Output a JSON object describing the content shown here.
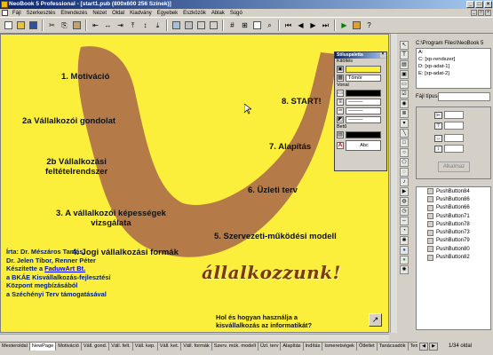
{
  "window": {
    "title": "NeoBook 5 Professional - [start1.pub (800x600 256 Színek)]"
  },
  "menu": {
    "items": [
      "Fájl",
      "Szerkesztés",
      "Elrendezés",
      "Nézet",
      "Oldal",
      "Kiadvány",
      "Egyebek",
      "Eszközök",
      "Ablak",
      "Súgó"
    ]
  },
  "canvas": {
    "items": [
      "1. Motiváció",
      "2a Vállalkozói gondolat",
      "2b Vállalkozási\nfeltételrendszer",
      "3. A vállalkozói képességek\nvizsgálata",
      "4. Jogi vállalkozási formák",
      "5. Szervezeti-működési modell",
      "6. Üzleti terv",
      "7. Alapítás",
      "8. START!"
    ],
    "credits": {
      "line1": "Írta: Dr. Mészáros Tamás,",
      "line2": "Dr. Jelen Tibor, Renner Péter",
      "line3_prefix": "Készítette a ",
      "line3_link": "FaduwArt Bt.",
      "line4": "a BKÁE Kisvállalkozás-fejlesztési",
      "line5": "Központ megbízásából",
      "line6": "a Széchényi Terv támogatásával"
    },
    "logo": "állalkozzunk!",
    "question_line1": "Hol és hogyan használja a",
    "question_line2": "kisvállalkozás az informatikát?",
    "colors": {
      "background": "#fbef3c",
      "shape": "#b47a48"
    }
  },
  "palette": {
    "title": "Stíluspaletta",
    "fill_label": "Kitöltés",
    "fill_value": "Tömör",
    "line_label": "Vonal",
    "text_label": "Betű",
    "font_sample": "Abc"
  },
  "right_panel": {
    "path": "C:\\Program Files\\NeoBook 5",
    "drives": [
      "A:",
      "C: [xp-rendszer]",
      "D: [xp-adat-1]",
      "E: [xp-adat-2]"
    ],
    "file_type_label": "Fájl típusa:",
    "apply_button": "Alkalmaz",
    "objects": [
      "PushButton84",
      "PushButton86",
      "PushButton66",
      "PushButton71",
      "PushButton78",
      "PushButton73",
      "PushButton79",
      "PushButton80",
      "PushButton82"
    ]
  },
  "tabs": [
    "Mesteroldal",
    "NewPage",
    "Motiváció",
    "Váll. gond.",
    "Váll. felt.",
    "Váll. kep.",
    "Váll. ket.",
    "Váll. formák",
    "Szerv. mük. modell",
    "Üzl. terv",
    "Alapítás",
    "Indítás",
    "Ismeretségek",
    "Ötletlet",
    "Tanácsadók",
    "Tematika"
  ],
  "status": {
    "page_info": "1/34 oldal"
  }
}
